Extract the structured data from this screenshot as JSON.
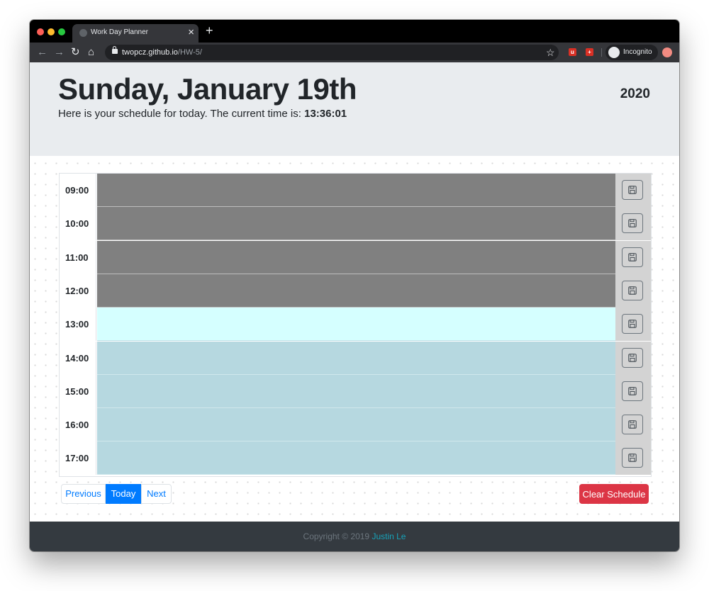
{
  "browser": {
    "tab_title": "Work Day Planner",
    "url_host": "twopcz.github.io",
    "url_path": "/HW-5/",
    "incognito_label": "Incognito"
  },
  "header": {
    "date": "Sunday, January 19th",
    "year": "2020",
    "lead_text": "Here is your schedule for today. The current time is: ",
    "current_time": "13:36:01"
  },
  "schedule": {
    "rows": [
      {
        "hour": "09:00",
        "state": "past",
        "task": ""
      },
      {
        "hour": "10:00",
        "state": "past",
        "task": ""
      },
      {
        "hour": "11:00",
        "state": "past",
        "task": ""
      },
      {
        "hour": "12:00",
        "state": "past",
        "task": ""
      },
      {
        "hour": "13:00",
        "state": "present",
        "task": ""
      },
      {
        "hour": "14:00",
        "state": "future",
        "task": ""
      },
      {
        "hour": "15:00",
        "state": "future",
        "task": ""
      },
      {
        "hour": "16:00",
        "state": "future",
        "task": ""
      },
      {
        "hour": "17:00",
        "state": "future",
        "task": ""
      }
    ],
    "save_icon": "floppy-disk-icon"
  },
  "pagination": {
    "previous": "Previous",
    "today": "Today",
    "next": "Next"
  },
  "actions": {
    "clear": "Clear Schedule"
  },
  "footer": {
    "copyright": "Copyright © 2019 ",
    "author": "Justin Le"
  },
  "colors": {
    "past": "#808080",
    "present": "#d5ffff",
    "future": "#b6d8e0",
    "primary": "#007bff",
    "danger": "#dc3545",
    "footer_bg": "#343a40",
    "author_link": "#17a2b8"
  }
}
